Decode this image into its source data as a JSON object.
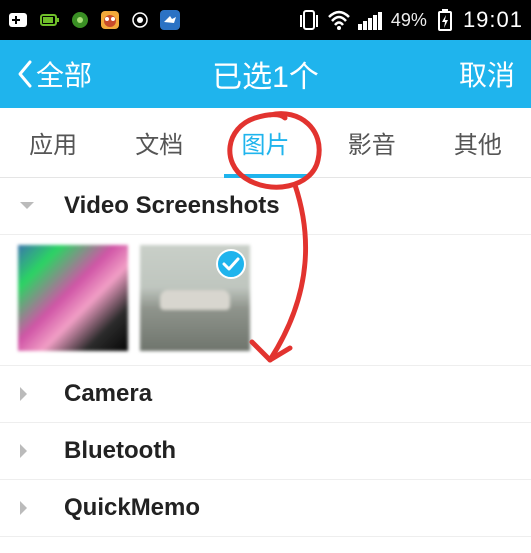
{
  "status_bar": {
    "battery_pct": "49%",
    "time": "19:01"
  },
  "header": {
    "back_label": "全部",
    "title": "已选1个",
    "cancel_label": "取消"
  },
  "tabs": {
    "t0": "应用",
    "t1": "文档",
    "t2": "图片",
    "t3": "影音",
    "t4": "其他",
    "active_index": 2
  },
  "folders": {
    "f0": {
      "name": "Video Screenshots",
      "expanded": true
    },
    "f1": {
      "name": "Camera",
      "expanded": false
    },
    "f2": {
      "name": "Bluetooth",
      "expanded": false
    },
    "f3": {
      "name": "QuickMemo",
      "expanded": false
    }
  },
  "thumbnails": {
    "count": 2,
    "selected_index": 1
  },
  "annotation": {
    "circle_target": "tab-images",
    "arrow_target": "folder-camera",
    "color": "#e2332f"
  }
}
